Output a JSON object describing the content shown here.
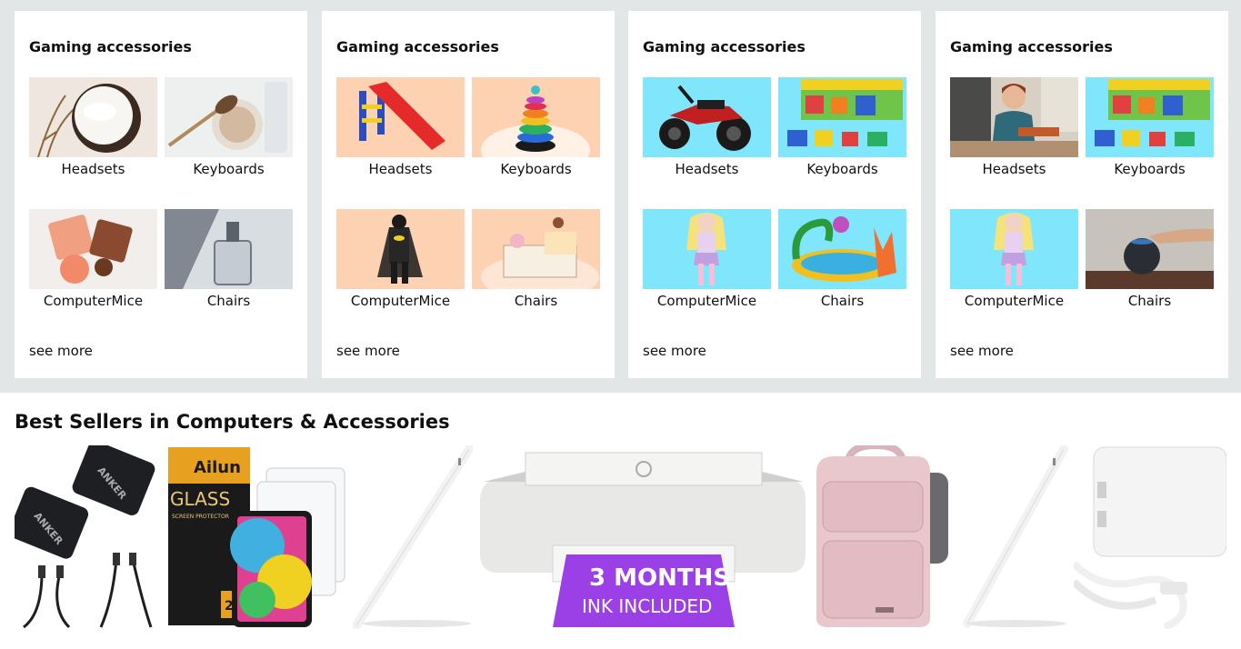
{
  "cards": [
    {
      "title": "Gaming accessories",
      "tiles": [
        {
          "label": "Headsets",
          "icon": "cream-jar-image"
        },
        {
          "label": "Keyboards",
          "icon": "makeup-brush-image"
        },
        {
          "label": "ComputerMice",
          "icon": "nail-polish-image"
        },
        {
          "label": "Chairs",
          "icon": "perfume-bottle-image"
        }
      ],
      "see_more": "see more"
    },
    {
      "title": "Gaming accessories",
      "tiles": [
        {
          "label": "Headsets",
          "icon": "toy-slide-image"
        },
        {
          "label": "Keyboards",
          "icon": "stacking-rings-image"
        },
        {
          "label": "ComputerMice",
          "icon": "batman-figure-image"
        },
        {
          "label": "Chairs",
          "icon": "ice-cream-playset-image"
        }
      ],
      "see_more": "see more"
    },
    {
      "title": "Gaming accessories",
      "tiles": [
        {
          "label": "Headsets",
          "icon": "ride-on-atv-image"
        },
        {
          "label": "Keyboards",
          "icon": "duplo-train-box-image"
        },
        {
          "label": "ComputerMice",
          "icon": "fashion-doll-image"
        },
        {
          "label": "Chairs",
          "icon": "inflatable-pool-image"
        }
      ],
      "see_more": "see more"
    },
    {
      "title": "Gaming accessories",
      "tiles": [
        {
          "label": "Headsets",
          "icon": "person-kitchen-image"
        },
        {
          "label": "Keyboards",
          "icon": "duplo-train-box-image"
        },
        {
          "label": "ComputerMice",
          "icon": "fashion-doll-image"
        },
        {
          "label": "Chairs",
          "icon": "smart-speaker-image"
        }
      ],
      "see_more": "see more"
    }
  ],
  "best_sellers": {
    "title": "Best Sellers in Computers & Accessories",
    "products": [
      {
        "icon": "usb-chargers-image",
        "brand_text": "ANKER"
      },
      {
        "icon": "screen-protector-image",
        "brand_text": "Ailun",
        "box_text": "GLASS",
        "sub_text": "SCREEN PROTECTOR",
        "badge_text": "2P"
      },
      {
        "icon": "stylus-pen-image"
      },
      {
        "icon": "hp-printer-image",
        "banner_line1": "3 MONTHS",
        "banner_line2": "INK INCLUDED"
      },
      {
        "icon": "pink-backpack-image"
      },
      {
        "icon": "stylus-pen-image"
      },
      {
        "icon": "usb-c-power-adapter-image"
      }
    ]
  },
  "colors": {
    "page_bg": "#e3e6e6",
    "card_bg": "#ffffff",
    "peach": "#fcd2b3",
    "cyan": "#7fe6fb",
    "printer_banner": "#9b3fe6"
  }
}
